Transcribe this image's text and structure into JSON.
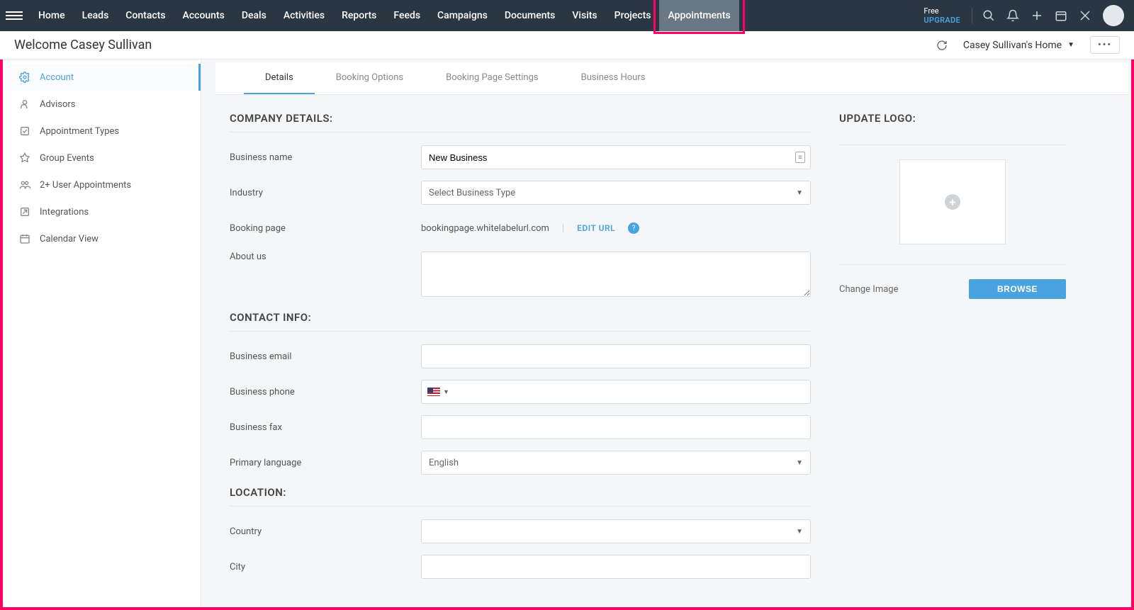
{
  "topnav": {
    "items": [
      "Home",
      "Leads",
      "Contacts",
      "Accounts",
      "Deals",
      "Activities",
      "Reports",
      "Feeds",
      "Campaigns",
      "Documents",
      "Visits",
      "Projects",
      "Appointments"
    ],
    "active_index": 12,
    "plan": "Free",
    "upgrade": "UPGRADE"
  },
  "subheader": {
    "welcome": "Welcome Casey Sullivan",
    "home_dropdown": "Casey Sullivan's Home"
  },
  "sidebar": {
    "items": [
      {
        "label": "Account",
        "icon": "gear"
      },
      {
        "label": "Advisors",
        "icon": "person"
      },
      {
        "label": "Appointment Types",
        "icon": "check"
      },
      {
        "label": "Group Events",
        "icon": "event"
      },
      {
        "label": "2+ User Appointments",
        "icon": "users"
      },
      {
        "label": "Integrations",
        "icon": "link"
      },
      {
        "label": "Calendar View",
        "icon": "calendar"
      }
    ],
    "active_index": 0
  },
  "tabs": {
    "items": [
      "Details",
      "Booking Options",
      "Booking Page Settings",
      "Business Hours"
    ],
    "active_index": 0
  },
  "sections": {
    "company": "COMPANY DETAILS:",
    "contact": "CONTACT INFO:",
    "location": "LOCATION:",
    "logo": "UPDATE LOGO:"
  },
  "labels": {
    "business_name": "Business name",
    "industry": "Industry",
    "booking_page": "Booking page",
    "about_us": "About us",
    "business_email": "Business email",
    "business_phone": "Business phone",
    "business_fax": "Business fax",
    "primary_language": "Primary language",
    "country": "Country",
    "city": "City",
    "change_image": "Change Image"
  },
  "values": {
    "business_name": "New Business",
    "industry_placeholder": "Select Business Type",
    "booking_page_url": "bookingpage.whitelabelurl.com",
    "edit_url": "EDIT URL",
    "primary_language": "English",
    "browse": "BROWSE"
  }
}
